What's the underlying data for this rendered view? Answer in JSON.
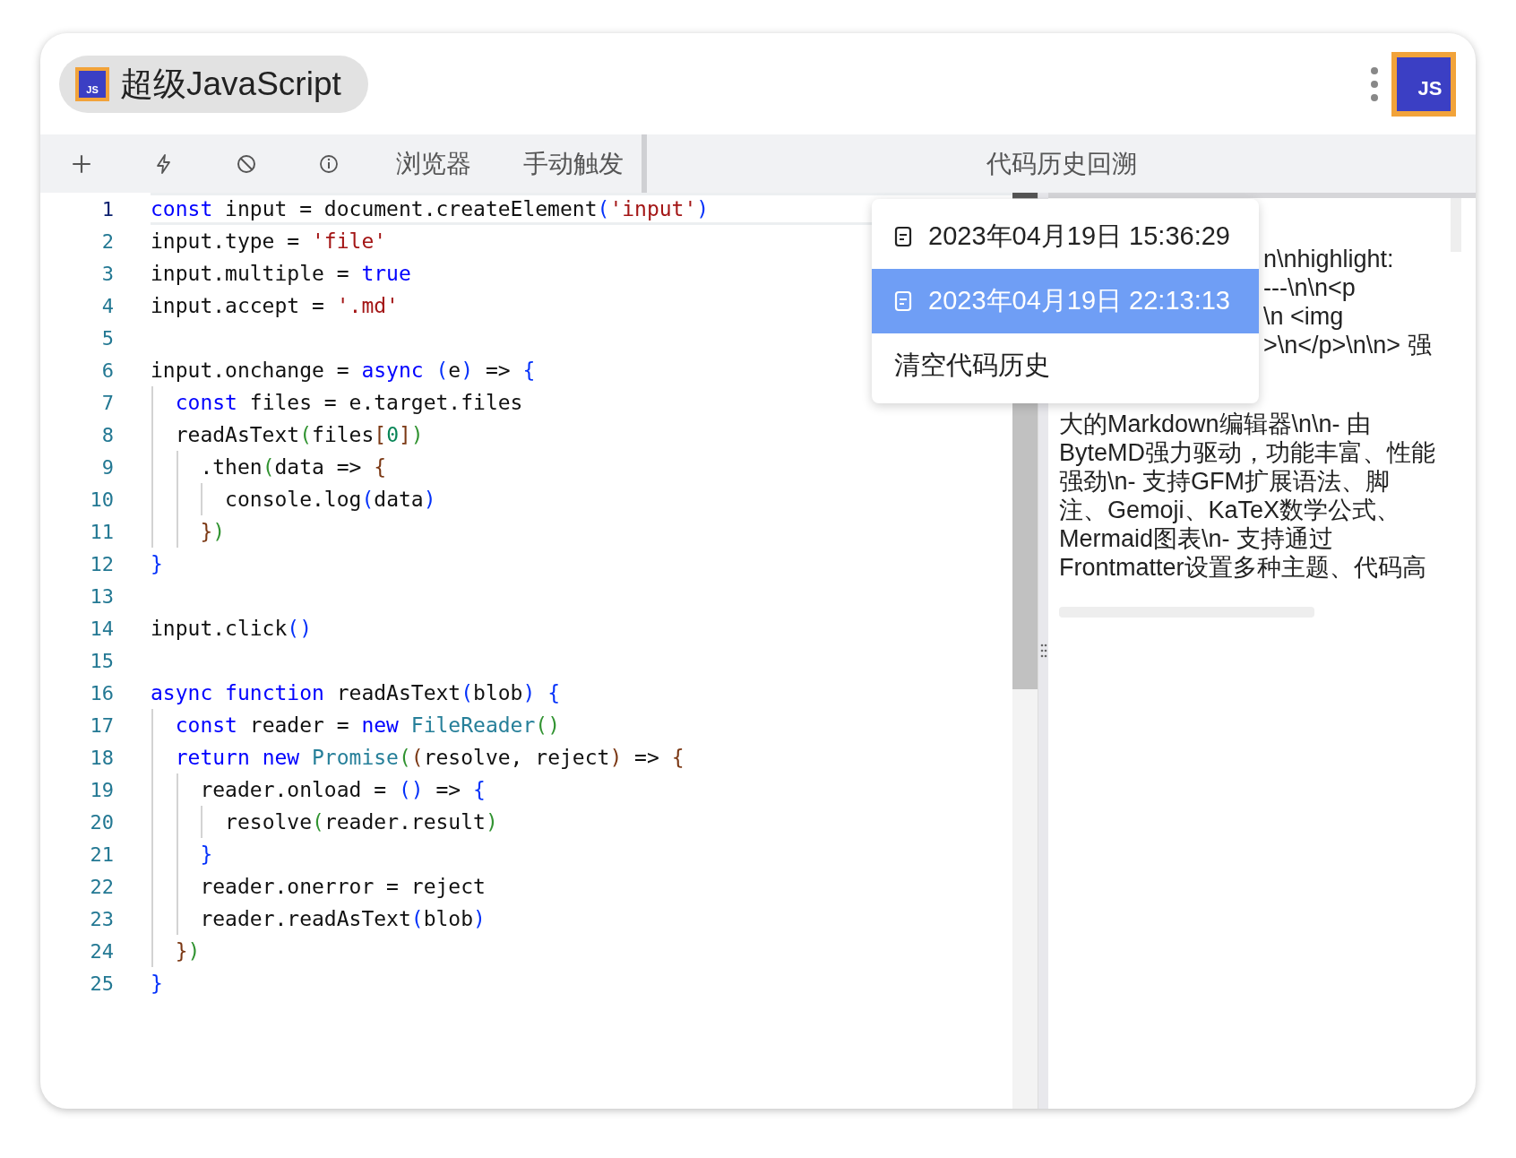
{
  "app": {
    "title": "超级JavaScript",
    "logo": "JS",
    "badge": "JS"
  },
  "toolbar": {
    "buttons": [
      {
        "kind": "add"
      },
      {
        "kind": "bolt"
      },
      {
        "kind": "ban"
      },
      {
        "kind": "info"
      },
      {
        "kind": "text",
        "label": "浏览器"
      },
      {
        "kind": "text",
        "label": "手动触发"
      }
    ],
    "tab": "代码历史回溯"
  },
  "editor": {
    "lines": [
      {
        "number": "1",
        "active": true,
        "tokens": [
          {
            "text": "const",
            "color": "#0000ff"
          },
          {
            "text": " input = document.createElement",
            "color": "#111111"
          },
          {
            "text": "(",
            "color": "#0431fa"
          },
          {
            "text": "'input'",
            "color": "#a31515"
          },
          {
            "text": ")",
            "color": "#0431fa"
          }
        ]
      },
      {
        "number": "2",
        "active": false,
        "tokens": [
          {
            "text": "input.type = ",
            "color": "#111111"
          },
          {
            "text": "'file'",
            "color": "#a31515"
          }
        ]
      },
      {
        "number": "3",
        "active": false,
        "tokens": [
          {
            "text": "input.multiple = ",
            "color": "#111111"
          },
          {
            "text": "true",
            "color": "#0000ff"
          }
        ]
      },
      {
        "number": "4",
        "active": false,
        "tokens": [
          {
            "text": "input.accept = ",
            "color": "#111111"
          },
          {
            "text": "'.md'",
            "color": "#a31515"
          }
        ]
      },
      {
        "number": "5",
        "active": false
      },
      {
        "number": "6",
        "active": false,
        "tokens": [
          {
            "text": "input.onchange = ",
            "color": "#111111"
          },
          {
            "text": "async",
            "color": "#0000ff"
          },
          {
            "text": " (",
            "color": "#0431fa"
          },
          {
            "text": "e",
            "color": "#111111"
          },
          {
            "text": ")",
            "color": "#0431fa"
          },
          {
            "text": " => ",
            "color": "#111111"
          },
          {
            "text": "{",
            "color": "#0431fa"
          }
        ],
        "children": [
          {
            "number": "7",
            "active": false,
            "tokens": [
              {
                "text": "const",
                "color": "#0000ff"
              },
              {
                "text": " files = e.target.files",
                "color": "#111111"
              }
            ]
          },
          {
            "number": "8",
            "active": false,
            "tokens": [
              {
                "text": "readAsText",
                "color": "#111111"
              },
              {
                "text": "(",
                "color": "#319331"
              },
              {
                "text": "files",
                "color": "#111111"
              },
              {
                "text": "[",
                "color": "#7b3814"
              },
              {
                "text": "0",
                "color": "#098658"
              },
              {
                "text": "]",
                "color": "#7b3814"
              },
              {
                "text": ")",
                "color": "#319331"
              }
            ],
            "children": [
              {
                "number": "9",
                "active": false,
                "tokens": [
                  {
                    "text": ".then",
                    "color": "#111111"
                  },
                  {
                    "text": "(",
                    "color": "#319331"
                  },
                  {
                    "text": "data => ",
                    "color": "#111111"
                  },
                  {
                    "text": "{",
                    "color": "#7b3814"
                  }
                ],
                "children": [
                  {
                    "number": "10",
                    "active": false,
                    "tokens": [
                      {
                        "text": "console.log",
                        "color": "#111111"
                      },
                      {
                        "text": "(",
                        "color": "#0431fa"
                      },
                      {
                        "text": "data",
                        "color": "#111111"
                      },
                      {
                        "text": ")",
                        "color": "#0431fa"
                      }
                    ]
                  }
                ]
              },
              {
                "number": "11",
                "active": false,
                "tokens": [
                  {
                    "text": "}",
                    "color": "#7b3814"
                  },
                  {
                    "text": ")",
                    "color": "#319331"
                  }
                ]
              }
            ]
          }
        ]
      },
      {
        "number": "12",
        "active": false,
        "tokens": [
          {
            "text": "}",
            "color": "#0431fa"
          }
        ]
      },
      {
        "number": "13",
        "active": false
      },
      {
        "number": "14",
        "active": false,
        "tokens": [
          {
            "text": "input.click",
            "color": "#111111"
          },
          {
            "text": "()",
            "color": "#0431fa"
          }
        ]
      },
      {
        "number": "15",
        "active": false
      },
      {
        "number": "16",
        "active": false,
        "tokens": [
          {
            "text": "async",
            "color": "#0000ff"
          },
          {
            "text": " function",
            "color": "#0000ff"
          },
          {
            "text": " readAsText",
            "color": "#111111"
          },
          {
            "text": "(",
            "color": "#0431fa"
          },
          {
            "text": "blob",
            "color": "#111111"
          },
          {
            "text": ")",
            "color": "#0431fa"
          },
          {
            "text": " {",
            "color": "#0431fa"
          }
        ],
        "children": [
          {
            "number": "17",
            "active": false,
            "tokens": [
              {
                "text": "const",
                "color": "#0000ff"
              },
              {
                "text": " reader = ",
                "color": "#111111"
              },
              {
                "text": "new",
                "color": "#0000ff"
              },
              {
                "text": " FileReader",
                "color": "#267f99"
              },
              {
                "text": "()",
                "color": "#319331"
              }
            ]
          },
          {
            "number": "18",
            "active": false,
            "tokens": [
              {
                "text": "return",
                "color": "#0000ff"
              },
              {
                "text": " new",
                "color": "#0000ff"
              },
              {
                "text": " Promise",
                "color": "#267f99"
              },
              {
                "text": "(",
                "color": "#319331"
              },
              {
                "text": "(",
                "color": "#7b3814"
              },
              {
                "text": "resolve, reject",
                "color": "#111111"
              },
              {
                "text": ")",
                "color": "#7b3814"
              },
              {
                "text": " => ",
                "color": "#111111"
              },
              {
                "text": "{",
                "color": "#7b3814"
              }
            ],
            "children": [
              {
                "number": "19",
                "active": false,
                "tokens": [
                  {
                    "text": "reader.onload = ",
                    "color": "#111111"
                  },
                  {
                    "text": "()",
                    "color": "#0431fa"
                  },
                  {
                    "text": " => ",
                    "color": "#111111"
                  },
                  {
                    "text": "{",
                    "color": "#0431fa"
                  }
                ],
                "children": [
                  {
                    "number": "20",
                    "active": false,
                    "tokens": [
                      {
                        "text": "resolve",
                        "color": "#111111"
                      },
                      {
                        "text": "(",
                        "color": "#319331"
                      },
                      {
                        "text": "reader.result",
                        "color": "#111111"
                      },
                      {
                        "text": ")",
                        "color": "#319331"
                      }
                    ]
                  }
                ]
              },
              {
                "number": "21",
                "active": false,
                "tokens": [
                  {
                    "text": "}",
                    "color": "#0431fa"
                  }
                ]
              },
              {
                "number": "22",
                "active": false,
                "tokens": [
                  {
                    "text": "reader.onerror = reject",
                    "color": "#111111"
                  }
                ]
              },
              {
                "number": "23",
                "active": false,
                "tokens": [
                  {
                    "text": "reader.readAsText",
                    "color": "#111111"
                  },
                  {
                    "text": "(",
                    "color": "#0431fa"
                  },
                  {
                    "text": "blob",
                    "color": "#111111"
                  },
                  {
                    "text": ")",
                    "color": "#0431fa"
                  }
                ]
              }
            ]
          },
          {
            "number": "24",
            "active": false,
            "tokens": [
              {
                "text": "}",
                "color": "#7b3814"
              },
              {
                "text": ")",
                "color": "#319331"
              }
            ]
          }
        ]
      },
      {
        "number": "25",
        "active": false,
        "tokens": [
          {
            "text": "}",
            "color": "#0431fa"
          }
        ]
      }
    ]
  },
  "history_menu": {
    "items": [
      {
        "kind": "entry",
        "label": "2023年04月19日 15:36:29",
        "selected": false
      },
      {
        "kind": "entry",
        "label": "2023年04月19日 22:13:13",
        "selected": true
      },
      {
        "kind": "action",
        "label": "清空代码历史"
      }
    ]
  },
  "preview": {
    "lines": [
      {
        "kind": "partial",
        "text": "n\\nhighlight:"
      },
      {
        "kind": "partial",
        "text": "---\\n\\n<p"
      },
      {
        "kind": "partial",
        "text": "\\n <img"
      },
      {
        "kind": "partial",
        "text": ">\\n</p>\\n\\n> 强"
      },
      {
        "kind": "full",
        "text": "大的Markdown编辑器\\n\\n- 由"
      },
      {
        "kind": "full",
        "text": "ByteMD强力驱动，功能丰富、性能"
      },
      {
        "kind": "full",
        "text": "强劲\\n- 支持GFM扩展语法、脚"
      },
      {
        "kind": "full",
        "text": "注、Gemoji、KaTeX数学公式、"
      },
      {
        "kind": "full",
        "text": "Mermaid图表\\n- 支持通过"
      },
      {
        "kind": "full",
        "text": "Frontmatter设置多种主题、代码高"
      }
    ]
  }
}
